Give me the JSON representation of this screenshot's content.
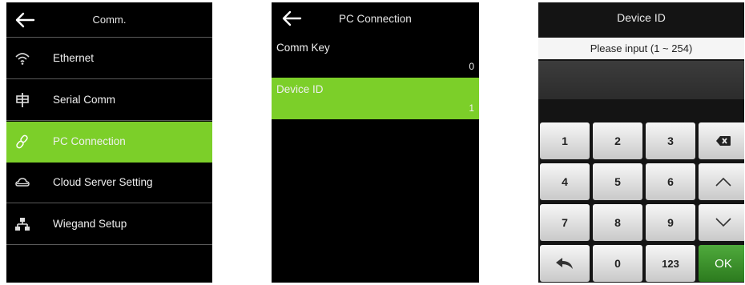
{
  "comm_screen": {
    "title": "Comm.",
    "items": [
      {
        "label": "Ethernet",
        "icon": "wifi-icon"
      },
      {
        "label": "Serial Comm",
        "icon": "serial-icon"
      },
      {
        "label": "PC Connection",
        "icon": "link-icon",
        "active": true
      },
      {
        "label": "Cloud Server Setting",
        "icon": "cloud-icon"
      },
      {
        "label": "Wiegand Setup",
        "icon": "network-icon"
      }
    ]
  },
  "pc_screen": {
    "title": "PC Connection",
    "fields": [
      {
        "name": "Comm Key",
        "value": "0"
      },
      {
        "name": "Device ID",
        "value": "1",
        "active": true
      }
    ]
  },
  "device_id_screen": {
    "title": "Device ID",
    "prompt": "Please input (1 ~ 254)",
    "keys": [
      "1",
      "2",
      "3",
      "4",
      "5",
      "6",
      "7",
      "8",
      "9",
      "0",
      "123",
      "OK"
    ]
  },
  "colors": {
    "accent": "#7ccf29",
    "ok_key": "#3c9a2c",
    "screen_bg": "#000000"
  }
}
